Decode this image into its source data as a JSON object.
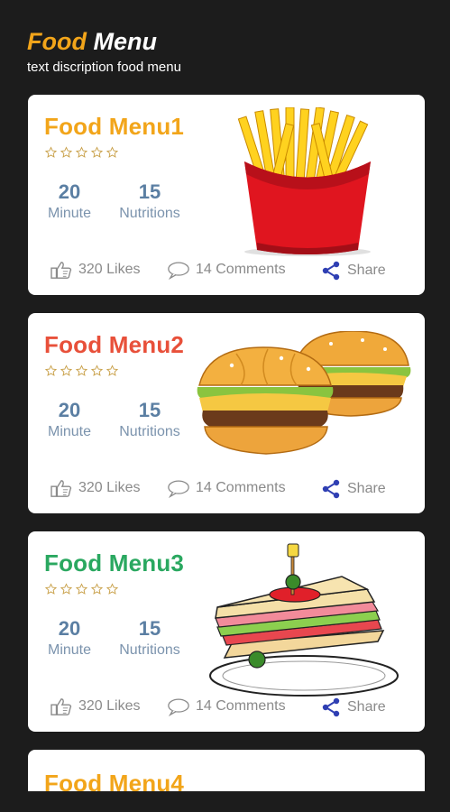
{
  "header": {
    "title_part1": "Food",
    "title_part2": "Menu",
    "subtitle": "text discription food menu"
  },
  "colors": {
    "background": "#1c1c1c",
    "card_title_1": "#f2a51a",
    "card_title_2": "#e8503a",
    "card_title_3": "#2aa860",
    "card_title_4": "#f2a51a",
    "share_blue": "#2f3fb3"
  },
  "cards": [
    {
      "title": "Food Menu1",
      "image": "french-fries",
      "rating": 0,
      "stat1_value": "20",
      "stat1_label": "Minute",
      "stat2_value": "15",
      "stat2_label": "Nutritions",
      "likes": "320 Likes",
      "comments": "14 Comments",
      "share": "Share"
    },
    {
      "title": "Food Menu2",
      "image": "burgers",
      "rating": 0,
      "stat1_value": "20",
      "stat1_label": "Minute",
      "stat2_value": "15",
      "stat2_label": "Nutritions",
      "likes": "320 Likes",
      "comments": "14 Comments",
      "share": "Share"
    },
    {
      "title": "Food Menu3",
      "image": "sandwich",
      "rating": 0,
      "stat1_value": "20",
      "stat1_label": "Minute",
      "stat2_value": "15",
      "stat2_label": "Nutritions",
      "likes": "320 Likes",
      "comments": "14 Comments",
      "share": "Share"
    },
    {
      "title": "Food Menu4"
    }
  ]
}
